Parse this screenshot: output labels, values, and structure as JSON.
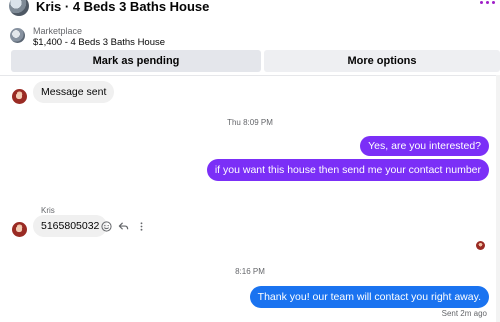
{
  "header": {
    "title": "Kris · 4 Beds 3 Baths House",
    "more_icon": "more-dots-icon",
    "accent": "#a020c8"
  },
  "listing": {
    "category": "Marketplace",
    "summary": "$1,400 - 4 Beds 3 Baths House"
  },
  "actions": {
    "mark_pending": "Mark as pending",
    "more_options": "More options"
  },
  "messages": {
    "m1": "Message sent",
    "ts1": "Thu 8:09 PM",
    "m2": "Yes, are you interested?",
    "m3": "if you want this house then send me your contact number",
    "sender": "Kris",
    "m4": "5165805032",
    "ts2": "8:16 PM",
    "m5": "Thank you! our team will contact you right away.",
    "status": "Sent 2m ago"
  },
  "colors": {
    "outgoing_purple": "#7b2ff7",
    "outgoing_blue": "#1a73f0",
    "incoming_bg": "#f0f0f0"
  }
}
